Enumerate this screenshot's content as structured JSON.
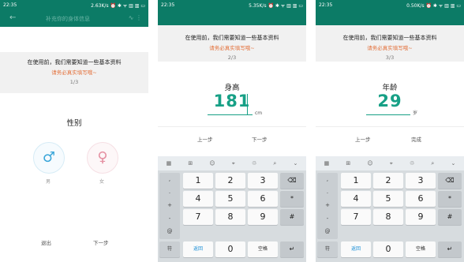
{
  "panels": [
    {
      "status": {
        "time": "22:35",
        "right": "2.63K/s ⏰ ✱ ᯤ ▥ ▥ ▭"
      },
      "appbar": {
        "title": "补充你的身体信息",
        "back": "←",
        "actions": "∿ ⋮"
      },
      "info": {
        "line1": "在使用前，我们需要知道一些基本资料",
        "line2": "请务必真实填写哦~",
        "step": "1/3"
      },
      "question": "性别",
      "options": [
        {
          "label": "男",
          "symbol": "♂",
          "color": "#3aa6d9"
        },
        {
          "label": "女",
          "symbol": "♀",
          "color": "#e58fa1"
        }
      ],
      "nav": {
        "prev": "退出",
        "next": "下一步"
      }
    },
    {
      "status": {
        "time": "22:35",
        "right": "5.35K/s ⏰ ✱ ᯤ ▥ ▥ ▭"
      },
      "info": {
        "line1": "在使用前，我们需要知道一些基本资料",
        "line2": "请务必真实填写哦~",
        "step": "2/3"
      },
      "question": "身高",
      "value": "181",
      "unit": "cm",
      "nav": {
        "prev": "上一步",
        "next": "下一步"
      }
    },
    {
      "status": {
        "time": "22:35",
        "right": "0.50K/s ⏰ ✱ ᯤ ▥ ▥ ▭"
      },
      "info": {
        "line1": "在使用前，我们需要知道一些基本资料",
        "line2": "请务必真实填写哦~",
        "step": "3/3"
      },
      "question": "年龄",
      "value": "29",
      "unit": "岁",
      "nav": {
        "prev": "上一步",
        "next": "完成"
      }
    }
  ],
  "keyboard": {
    "toolbar": [
      "▦",
      "⊞",
      "☺",
      "⌖",
      "♲",
      "⌕",
      "⌄"
    ],
    "symbols": [
      ",",
      ".",
      "+",
      "-",
      "@"
    ],
    "digits": [
      "1",
      "2",
      "3",
      "4",
      "5",
      "6",
      "7",
      "8",
      "9",
      "0"
    ],
    "backspace": "⌫",
    "star": "*",
    "hash": "#",
    "symbol_key": "符",
    "back_key": "返回",
    "space_key": "空格",
    "enter_key": "↵"
  }
}
